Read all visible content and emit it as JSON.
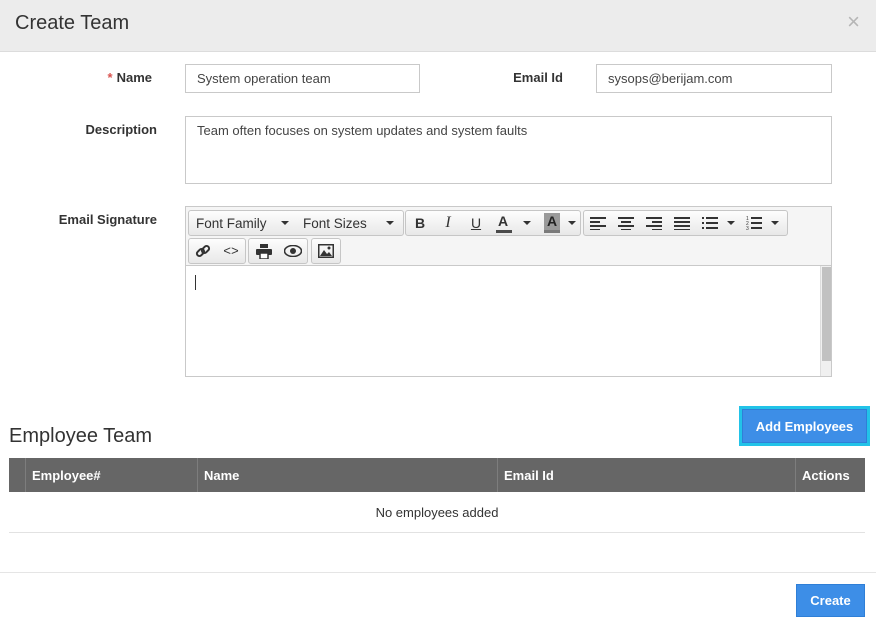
{
  "modal": {
    "title": "Create Team",
    "close_glyph": "×"
  },
  "form": {
    "name_required_mark": "*",
    "name_label": "Name",
    "name_value": "System operation team",
    "email_label": "Email Id",
    "email_value": "sysops@berijam.com",
    "description_label": "Description",
    "description_value": "Team often focuses on system updates and system faults",
    "signature_label": "Email Signature"
  },
  "editor": {
    "font_family": "Font Family",
    "font_sizes": "Font Sizes",
    "bold": "B",
    "italic": "I",
    "underline": "U",
    "text_color": "A",
    "bg_color": "A",
    "text_color_bar": "#4a4a4a",
    "bg_color_bar": "#7a7a7a",
    "icons": [
      "bold-icon",
      "italic-icon",
      "underline-icon",
      "text-color-icon",
      "background-color-icon",
      "align-left-icon",
      "align-center-icon",
      "align-right-icon",
      "align-justify-icon",
      "bullet-list-icon",
      "numbered-list-icon",
      "link-icon",
      "code-view-icon",
      "print-icon",
      "preview-icon",
      "image-icon"
    ]
  },
  "employees": {
    "title": "Employee Team",
    "add_button": "Add Employees",
    "columns": [
      "Employee#",
      "Name",
      "Email Id",
      "Actions"
    ],
    "empty_message": "No employees added"
  },
  "footer": {
    "create_button": "Create"
  },
  "colors": {
    "primary": "#3d8ee7",
    "focus_ring": "#22c3e8",
    "table_header": "#666666",
    "required": "#d9534f"
  }
}
